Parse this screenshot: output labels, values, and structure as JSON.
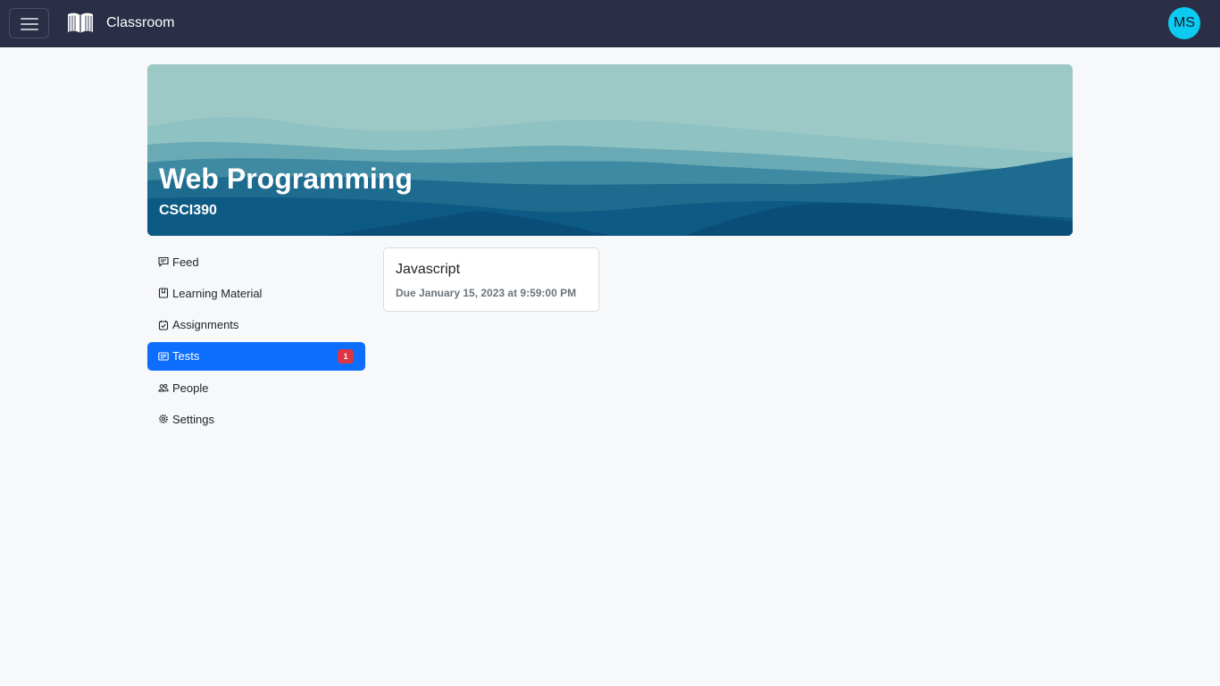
{
  "navbar": {
    "menu_icon": "hamburger-icon",
    "brand_icon": "open-book-icon",
    "brand_name": "Classroom",
    "avatar_initials": "MS",
    "colors": {
      "background": "#2a2f47",
      "avatar": "#0dcaf0"
    }
  },
  "course": {
    "title": "Web Programming",
    "code": "CSCI390"
  },
  "sidebar": {
    "items": [
      {
        "label": "Feed",
        "icon": "chat-square-icon",
        "active": false
      },
      {
        "label": "Learning Material",
        "icon": "journal-icon",
        "active": false
      },
      {
        "label": "Assignments",
        "icon": "calendar-check-icon",
        "active": false
      },
      {
        "label": "Tests",
        "icon": "card-text-icon",
        "active": true,
        "badge": "1"
      },
      {
        "label": "People",
        "icon": "people-icon",
        "active": false
      },
      {
        "label": "Settings",
        "icon": "gear-icon",
        "active": false
      }
    ]
  },
  "tests": [
    {
      "title": "Javascript",
      "due": "Due January 15, 2023 at 9:59:00 PM"
    }
  ],
  "colors": {
    "active": "#0d6efd",
    "badge": "#dc3545",
    "page_bg": "#f7f8fa"
  }
}
